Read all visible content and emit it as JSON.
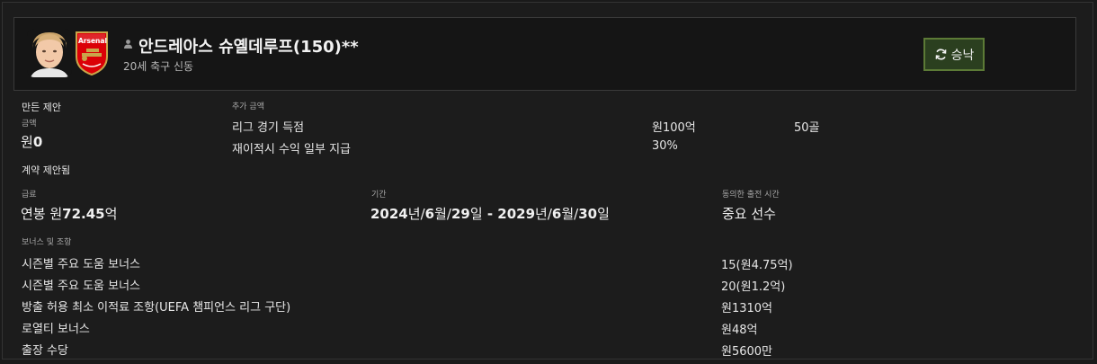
{
  "player": {
    "name": "안드레아스 슈옐데루프(150)**",
    "subtitle": "20세 축구 신동",
    "club": "Arsenal",
    "accept_label": "승낙"
  },
  "upfront": {
    "title": "만든 제안",
    "amount_label": "금액",
    "currency": "원",
    "amount_value": "0"
  },
  "additional": {
    "title": "추가 금액",
    "rows": [
      {
        "label": "리그 경기 득점",
        "value": "원100억",
        "extra": "50골"
      },
      {
        "label": "재이적시 수익 일부 지급",
        "value": "30%",
        "extra": ""
      }
    ]
  },
  "contract": {
    "title": "계약 제안됨",
    "wage_label": "급료",
    "wage_prefix": "연봉 원",
    "wage_value": "72.45",
    "wage_unit": "억",
    "period_label": "기간",
    "period": {
      "start_y": "2024",
      "start_m": "6",
      "start_d": "29",
      "end_y": "2029",
      "end_m": "6",
      "end_d": "30",
      "unit_y": "년",
      "unit_m": "월",
      "unit_d": "일",
      "sep": "/",
      "dash": " - "
    },
    "playing_label": "동의한 출전 시간",
    "playing_value": "중요 선수"
  },
  "bonuses": {
    "title": "보너스 및 조항",
    "rows": [
      {
        "label": "시즌별 주요 도움 보너스",
        "value": "15(원4.75억)"
      },
      {
        "label": "시즌별 주요 도움 보너스",
        "value": "20(원1.2억)"
      },
      {
        "label": "방출 허용 최소 이적료 조항(UEFA 챔피언스 리그 구단)",
        "value": "원1310억"
      },
      {
        "label": "로열티 보너스",
        "value": "원48억"
      },
      {
        "label": "출장 수당",
        "value": "원5600만"
      }
    ]
  },
  "colors": {
    "accept_bg": "#2b3f1f",
    "accept_border": "#5c7a36",
    "arsenal_red": "#db0007"
  }
}
